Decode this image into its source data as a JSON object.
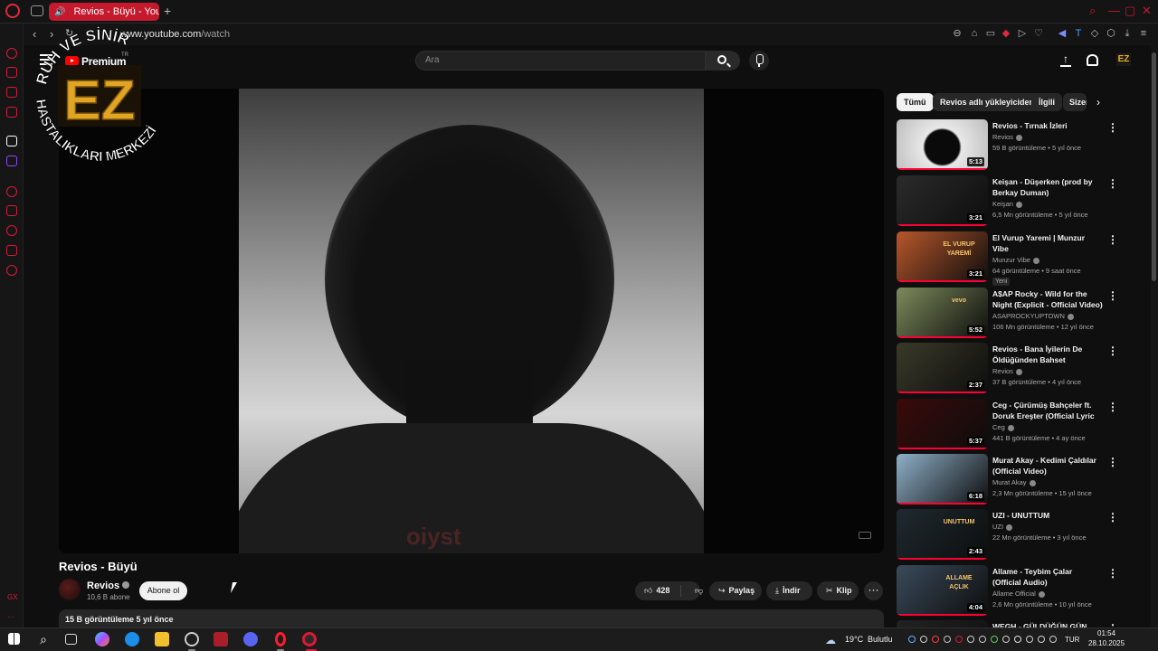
{
  "browser": {
    "tab_title": "Revios - Büyü - YouTube",
    "tab_add": "+",
    "url_domain": "www.youtube.com",
    "url_path": "/watch"
  },
  "header": {
    "premium": "Premium",
    "region": "TR",
    "search_placeholder": "Ara",
    "avatar_text": "EZ"
  },
  "video": {
    "title": "Revios - Büyü",
    "shirt_text": "oiyst",
    "channel": "Revios",
    "subscribers": "10,6 B abone",
    "subscribe_label": "Abone ol",
    "likes": "428",
    "share_label": "Paylaş",
    "download_label": "İndir",
    "clip_label": "Klip",
    "more_label": "···",
    "views_and_date": "15 B görüntüleme  5 yıl önce"
  },
  "chips": [
    "Tümü",
    "Revios adlı yükleyiciden",
    "İlgili",
    "Sizer"
  ],
  "recommendations": [
    {
      "title": "Revios - Tırnak İzleri",
      "channel": "Revios",
      "meta": "59 B görüntüleme • 5 yıl önce",
      "duration": "5:13",
      "thumb": "#d7d7d7",
      "badge": ""
    },
    {
      "title": "Keişan - Düşerken (prod by Berkay Duman)",
      "channel": "Keişan",
      "meta": "6,5 Mn görüntüleme • 5 yıl önce",
      "duration": "3:21",
      "thumb": "#2b2b2b",
      "badge": ""
    },
    {
      "title": "El Vurup Yaremi | Munzur Vibe",
      "channel": "Munzur Vibe",
      "meta": "64 görüntüleme • 9 saat önce",
      "duration": "3:21",
      "thumb": "#b8572b",
      "badge": "Yeni",
      "thumb_text": "EL VURUP YAREMİ"
    },
    {
      "title": "A$AP Rocky - Wild for the Night (Explicit - Official Video) ft. ...",
      "channel": "ASAPROCKYUPTOWN",
      "meta": "106 Mn görüntüleme • 12 yıl önce",
      "duration": "5:52",
      "thumb": "#7d8a5a",
      "badge": "",
      "thumb_text": "vevo"
    },
    {
      "title": "Revios - Bana İyilerin De Öldüğünden Bahset",
      "channel": "Revios",
      "meta": "37 B görüntüleme • 4 yıl önce",
      "duration": "2:37",
      "thumb": "#3a3a2a",
      "badge": ""
    },
    {
      "title": "Ceg - Çürümüş Bahçeler ft. Doruk Ereşter (Official Lyric ...",
      "channel": "Ceg",
      "meta": "441 B görüntüleme • 4 ay önce",
      "duration": "5:37",
      "thumb": "#3a0a0a",
      "badge": ""
    },
    {
      "title": "Murat Akay - Kedimi Çaldılar (Official Video)",
      "channel": "Murat Akay",
      "meta": "2,3 Mn görüntüleme • 15 yıl önce",
      "duration": "6:18",
      "thumb": "#8fb0c8",
      "badge": ""
    },
    {
      "title": "UZI - UNUTTUM",
      "channel": "UZI",
      "meta": "22 Mn görüntüleme • 3 yıl önce",
      "duration": "2:43",
      "thumb": "#1e2a30",
      "badge": "",
      "thumb_text": "UNUTTUM"
    },
    {
      "title": "Allame - Teybim Çalar (Official Audio)",
      "channel": "Allame Official",
      "meta": "2,6 Mn görüntüleme • 10 yıl önce",
      "duration": "4:04",
      "thumb": "#3a4a5a",
      "badge": "",
      "thumb_text": "ALLAME AÇLIK"
    },
    {
      "title": "WEGH - GÜLDÜĞÜN GÜN",
      "channel": "",
      "meta": "",
      "duration": "",
      "thumb": "#222",
      "badge": ""
    }
  ],
  "watermark": {
    "top_text": "RUH VE SİNİR",
    "bottom_text": "HASTALIKLARI MERKEZİ",
    "center": "EZ"
  },
  "taskbar": {
    "weather_temp": "19°C",
    "weather_desc": "Bulutlu",
    "language": "TUR",
    "time": "01:54",
    "date": "28.10.2025"
  },
  "colors": {
    "accent": "#c5192d",
    "yt_red": "#ff0000",
    "gold": "#e8b319"
  }
}
